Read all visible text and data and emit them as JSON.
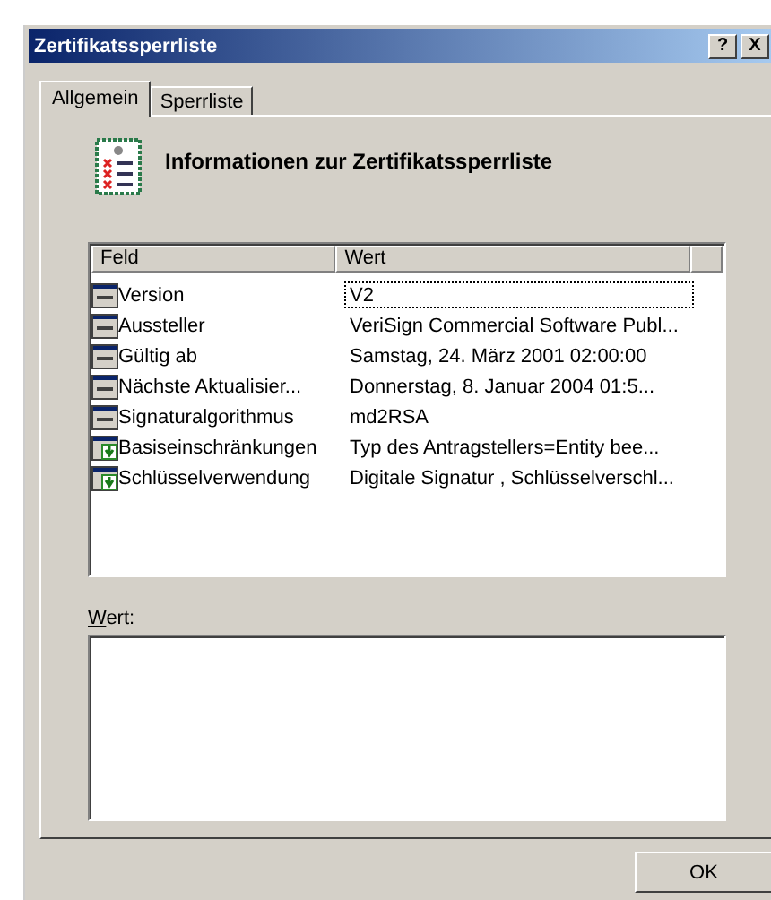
{
  "window": {
    "title": "Zertifikatssperrliste",
    "help_button": "?",
    "close_button": "X"
  },
  "tabs": [
    {
      "label": "Allgemein",
      "selected": true
    },
    {
      "label": "Sperrliste",
      "selected": false
    }
  ],
  "heading": "Informationen zur Zertifikatssperrliste",
  "table": {
    "columns": [
      "Feld",
      "Wert"
    ],
    "rows": [
      {
        "kind": "field",
        "field": "Version",
        "value": "V2",
        "selected": true
      },
      {
        "kind": "field",
        "field": "Aussteller",
        "value": "VeriSign Commercial Software Publ...",
        "selected": false
      },
      {
        "kind": "field",
        "field": "Gültig ab",
        "value": "Samstag, 24. März 2001 02:00:00",
        "selected": false
      },
      {
        "kind": "field",
        "field": "Nächste Aktualisier...",
        "value": "Donnerstag, 8. Januar 2004 01:5...",
        "selected": false
      },
      {
        "kind": "field",
        "field": "Signaturalgorithmus",
        "value": "md2RSA",
        "selected": false
      },
      {
        "kind": "extension",
        "field": "Basiseinschränkungen",
        "value": "Typ des Antragstellers=Entity bee...",
        "selected": false
      },
      {
        "kind": "extension",
        "field": "Schlüsselverwendung",
        "value": "Digitale Signatur , Schlüsselverschl...",
        "selected": false
      }
    ]
  },
  "value_label": "Wert:",
  "buttons": [
    "OK"
  ]
}
